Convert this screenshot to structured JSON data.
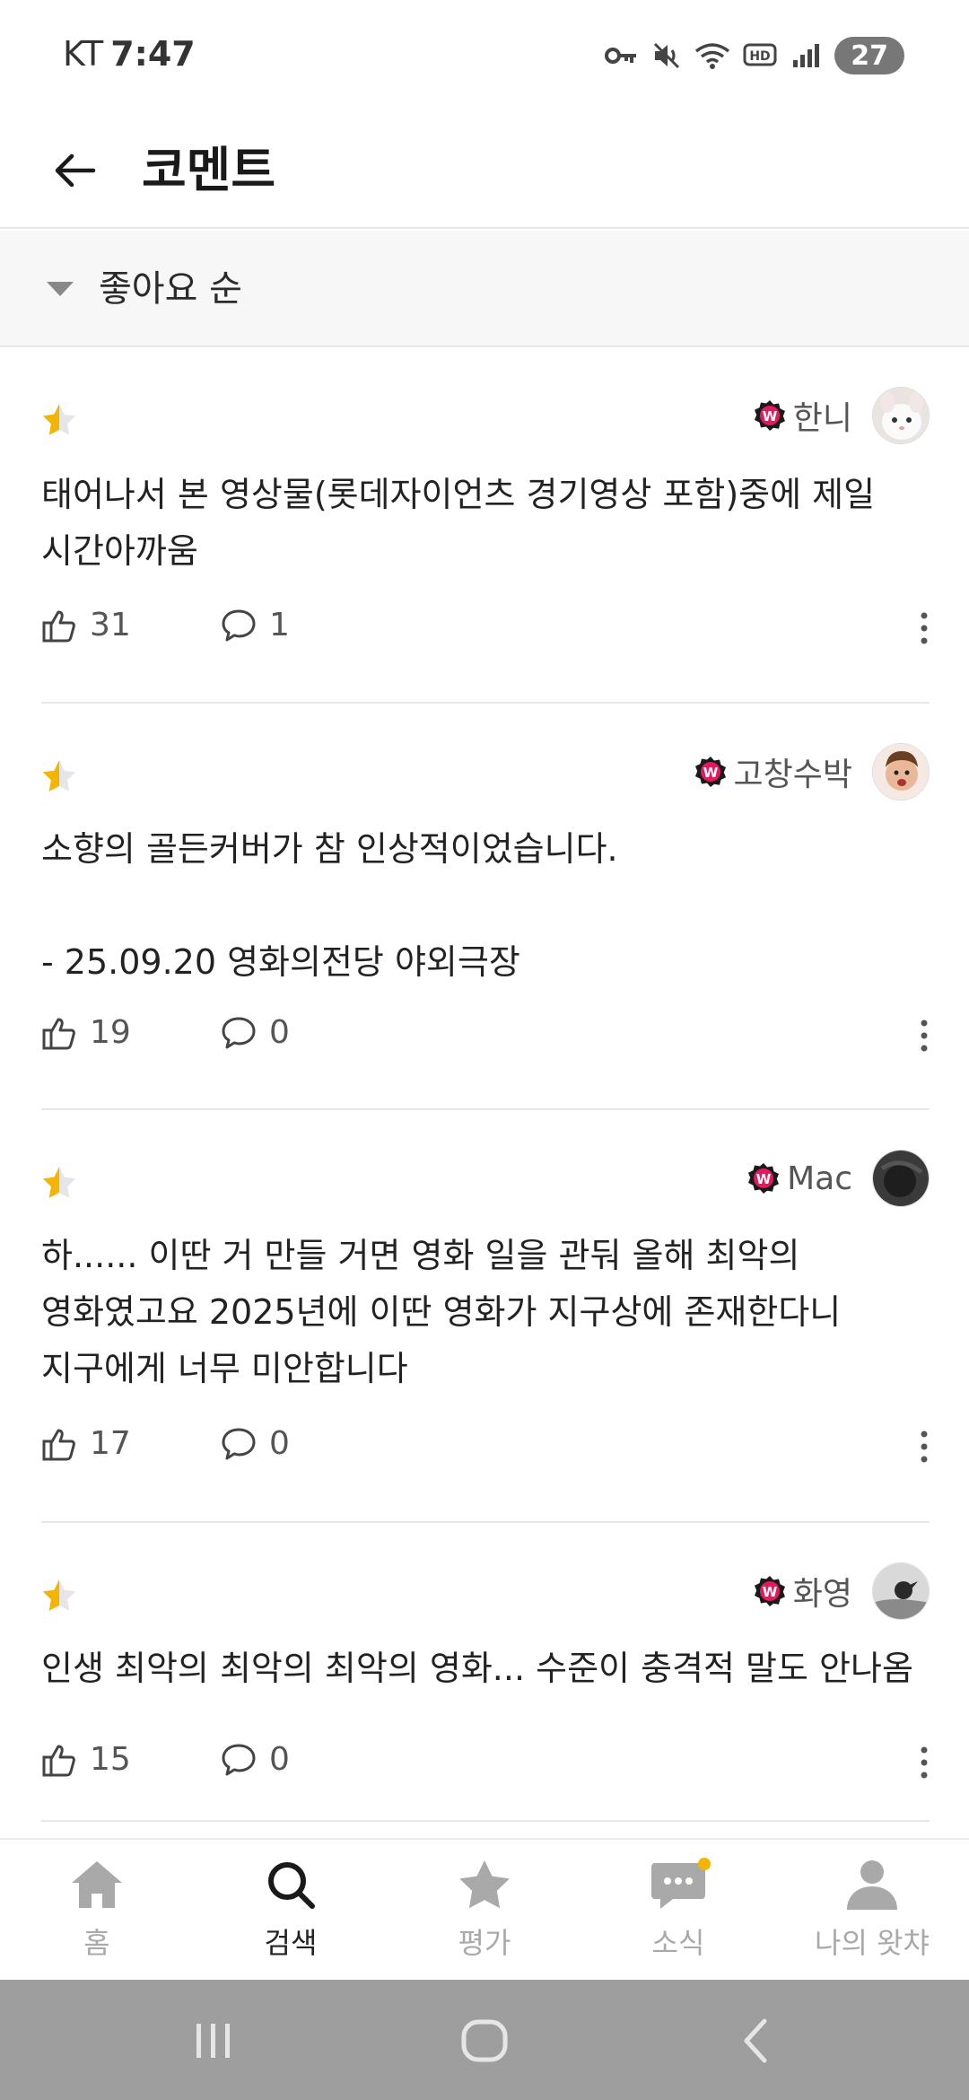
{
  "status_bar": {
    "carrier": "KT",
    "time": "7:47",
    "battery": "27",
    "icons": [
      "key-icon",
      "mute-icon",
      "wifi-icon",
      "hd-icon",
      "signal-icon"
    ]
  },
  "header": {
    "title": "코멘트",
    "back_icon": "back-arrow-icon"
  },
  "sort": {
    "label": "좋아요 순"
  },
  "comments": [
    {
      "rating_icon": "half-star",
      "username": "한니",
      "text": "태어나서 본 영상물(롯데자이언츠 경기영상 포함)중에 제일\n시간아까움",
      "likes": "31",
      "replies": "1"
    },
    {
      "rating_icon": "half-star",
      "username": "고창수박",
      "text": "소향의 골든커버가 참 인상적이었습니다.\n\n- 25.09.20 영화의전당 야외극장",
      "likes": "19",
      "replies": "0"
    },
    {
      "rating_icon": "half-star",
      "username": "Mac",
      "text": "하...... 이딴 거 만들 거면 영화 일을 관둬 올해 최악의\n영화였고요 2025년에 이딴 영화가 지구상에 존재한다니\n지구에게 너무 미안합니다",
      "likes": "17",
      "replies": "0"
    },
    {
      "rating_icon": "half-star",
      "username": "화영",
      "text": "인생 최악의 최악의 최악의 영화... 수준이 충격적 말도 안나옴",
      "likes": "15",
      "replies": "0"
    }
  ],
  "bottom_nav": [
    {
      "label": "홈",
      "icon": "home-icon",
      "active": false
    },
    {
      "label": "검색",
      "icon": "search-icon",
      "active": true
    },
    {
      "label": "평가",
      "icon": "star-icon",
      "active": false
    },
    {
      "label": "소식",
      "icon": "chat-icon",
      "active": false
    },
    {
      "label": "나의 왓챠",
      "icon": "person-icon",
      "active": false
    }
  ],
  "colors": {
    "accent": "#f4b400",
    "badge": "#e6195f",
    "inactive": "#a9a9a9"
  }
}
